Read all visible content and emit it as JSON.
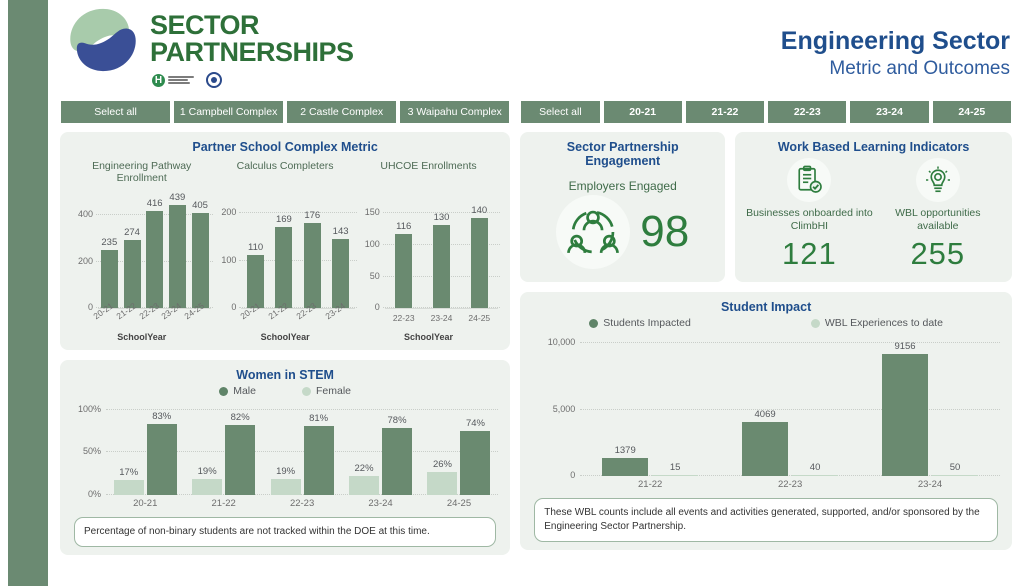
{
  "brand": {
    "logo_line1": "SECTOR",
    "logo_line2": "PARTNERSHIPS",
    "logo_icon": "sector-partnerships-swoosh-logo",
    "partner_logo_1": "hawaii-doe-h-logo",
    "partner_logo_2": "state-seal-logo",
    "accent_green": "#2e7039",
    "accent_blue": "#1f4e8c",
    "bar_dark": "#6a8a70",
    "bar_light": "#c5d9c8",
    "sidebar_color": "#6b8a72"
  },
  "header": {
    "title": "Engineering Sector",
    "subtitle": "Metric and Outcomes"
  },
  "slicers": {
    "complex": {
      "name": "complex-slicer",
      "buttons": [
        "Select all",
        "1 Campbell Complex",
        "2 Castle Complex",
        "3 Waipahu Complex"
      ]
    },
    "school_year": {
      "name": "school-year-slicer",
      "buttons": [
        "Select all",
        "20-21",
        "21-22",
        "22-23",
        "23-24",
        "24-25"
      ]
    }
  },
  "partner_school": {
    "title": "Partner School Complex Metric",
    "charts": [
      {
        "title": "Engineering Pathway Enrollment",
        "xlabel": "SchoolYear",
        "yticks": [
          "0",
          "200",
          "400"
        ],
        "categories": [
          "20-21",
          "21-22",
          "22-23",
          "23-24",
          "24-25"
        ],
        "values": [
          235,
          274,
          416,
          439,
          405
        ]
      },
      {
        "title": "Calculus Completers",
        "xlabel": "SchoolYear",
        "yticks": [
          "0",
          "100",
          "200"
        ],
        "categories": [
          "20-21",
          "21-22",
          "22-23",
          "23-24"
        ],
        "values": [
          110,
          169,
          176,
          143
        ]
      },
      {
        "title": "UHCOE Enrollments",
        "xlabel": "SchoolYear",
        "yticks": [
          "0",
          "50",
          "100",
          "150"
        ],
        "categories": [
          "22-23",
          "23-24",
          "24-25"
        ],
        "values": [
          116,
          130,
          140
        ]
      }
    ]
  },
  "women_in_stem": {
    "title": "Women in STEM",
    "legend": [
      "Male",
      "Female"
    ],
    "yticks": [
      "0%",
      "50%",
      "100%"
    ],
    "categories": [
      "20-21",
      "21-22",
      "22-23",
      "23-24",
      "24-25"
    ],
    "female": [
      17,
      19,
      19,
      22,
      26
    ],
    "male": [
      83,
      82,
      81,
      78,
      74
    ],
    "female_labels": [
      "17%",
      "19%",
      "19%",
      "22%",
      "26%"
    ],
    "male_labels": [
      "83%",
      "82%",
      "81%",
      "78%",
      "74%"
    ],
    "note": "Percentage of non-binary students are not tracked within the DOE at this time."
  },
  "engagement": {
    "title": "Sector Partnership Engagement",
    "sublabel": "Employers Engaged",
    "icon": "people-network-icon",
    "value": "98"
  },
  "wbl_indicators": {
    "title": "Work Based Learning Indicators",
    "items": [
      {
        "icon": "clipboard-check-icon",
        "label": "Businesses onboarded into ClimbHI",
        "value": "121"
      },
      {
        "icon": "lightbulb-idea-icon",
        "label": "WBL opportunities available",
        "value": "255"
      }
    ]
  },
  "student_impact": {
    "title": "Student Impact",
    "legend": [
      "Students Impacted",
      "WBL Experiences to date"
    ],
    "yticks": [
      "0",
      "5,000",
      "10,000"
    ],
    "categories": [
      "21-22",
      "22-23",
      "23-24"
    ],
    "students_impacted": [
      1379,
      4069,
      9156
    ],
    "wbl_experiences": [
      15,
      40,
      50
    ],
    "students_labels": [
      "1379",
      "4069",
      "9156"
    ],
    "wbl_labels": [
      "15",
      "40",
      "50"
    ],
    "note": "These WBL counts include all events and activities generated, supported, and/or sponsored by the Engineering Sector Partnership."
  },
  "chart_data": [
    {
      "type": "bar",
      "title": "Engineering Pathway Enrollment",
      "xlabel": "SchoolYear",
      "ylabel": "",
      "categories": [
        "20-21",
        "21-22",
        "22-23",
        "23-24",
        "24-25"
      ],
      "values": [
        235,
        274,
        416,
        439,
        405
      ],
      "ylim": [
        0,
        480
      ],
      "yticks": [
        0,
        200,
        400
      ],
      "grid": true,
      "legend": "none"
    },
    {
      "type": "bar",
      "title": "Calculus Completers",
      "xlabel": "SchoolYear",
      "ylabel": "",
      "categories": [
        "20-21",
        "21-22",
        "22-23",
        "23-24"
      ],
      "values": [
        110,
        169,
        176,
        143
      ],
      "ylim": [
        0,
        215
      ],
      "yticks": [
        0,
        100,
        200
      ],
      "grid": true,
      "legend": "none"
    },
    {
      "type": "bar",
      "title": "UHCOE Enrollments",
      "xlabel": "SchoolYear",
      "ylabel": "",
      "categories": [
        "22-23",
        "23-24",
        "24-25"
      ],
      "values": [
        116,
        130,
        140
      ],
      "ylim": [
        0,
        155
      ],
      "yticks": [
        0,
        50,
        100,
        150
      ],
      "grid": true,
      "legend": "none"
    },
    {
      "type": "bar",
      "title": "Women in STEM",
      "xlabel": "",
      "ylabel": "",
      "categories": [
        "20-21",
        "21-22",
        "22-23",
        "23-24",
        "24-25"
      ],
      "series": [
        {
          "name": "Female",
          "values": [
            17,
            19,
            19,
            22,
            26
          ],
          "color": "#c5d9c8"
        },
        {
          "name": "Male",
          "values": [
            83,
            82,
            81,
            78,
            74
          ],
          "color": "#6a8a70"
        }
      ],
      "ylim": [
        0,
        100
      ],
      "yticks": [
        0,
        50,
        100
      ],
      "tick_format": "percent",
      "grid": true,
      "legend": "top"
    },
    {
      "type": "bar",
      "title": "Student Impact",
      "xlabel": "",
      "ylabel": "",
      "categories": [
        "21-22",
        "22-23",
        "23-24"
      ],
      "series": [
        {
          "name": "Students Impacted",
          "values": [
            1379,
            4069,
            9156
          ],
          "color": "#6a8a70"
        },
        {
          "name": "WBL Experiences to date",
          "values": [
            15,
            40,
            50
          ],
          "color": "#c5d9c8"
        }
      ],
      "ylim": [
        0,
        10500
      ],
      "yticks": [
        0,
        5000,
        10000
      ],
      "grid": true,
      "legend": "top"
    }
  ]
}
